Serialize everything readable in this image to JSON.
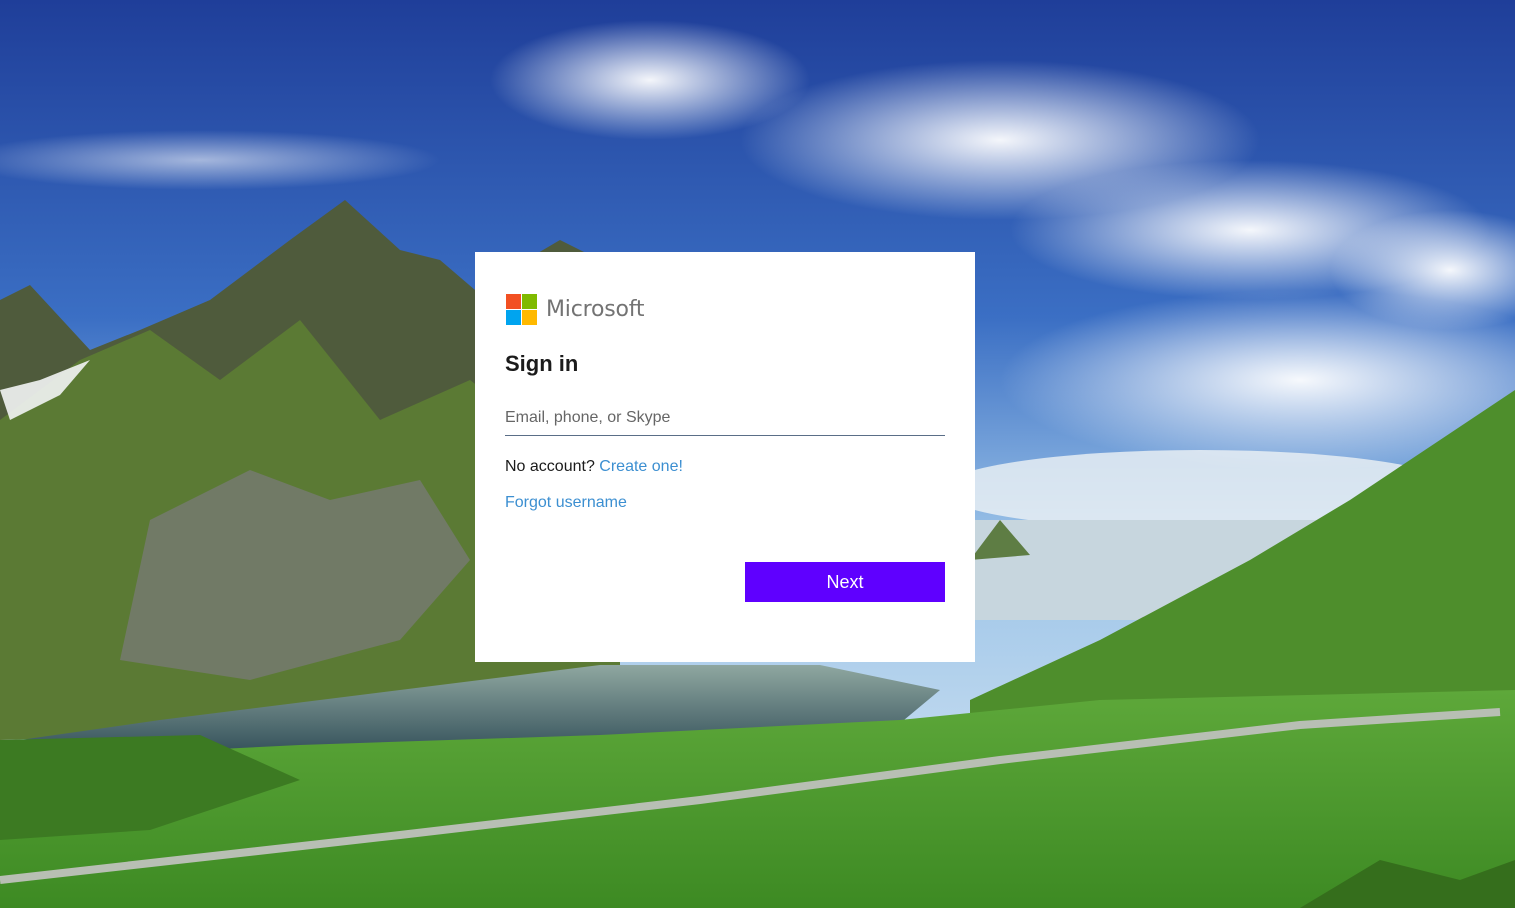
{
  "brand": {
    "name": "Microsoft",
    "logo_colors": [
      "#f25022",
      "#7fba00",
      "#00a4ef",
      "#ffb900"
    ]
  },
  "signin": {
    "title": "Sign in",
    "email_placeholder": "Email, phone, or Skype",
    "email_value": "",
    "no_account_text": "No account?",
    "create_link": "Create one!",
    "forgot_link": "Forgot username",
    "next_label": "Next"
  },
  "colors": {
    "accent_button": "#5f00ff",
    "link": "#3c8fd1"
  }
}
